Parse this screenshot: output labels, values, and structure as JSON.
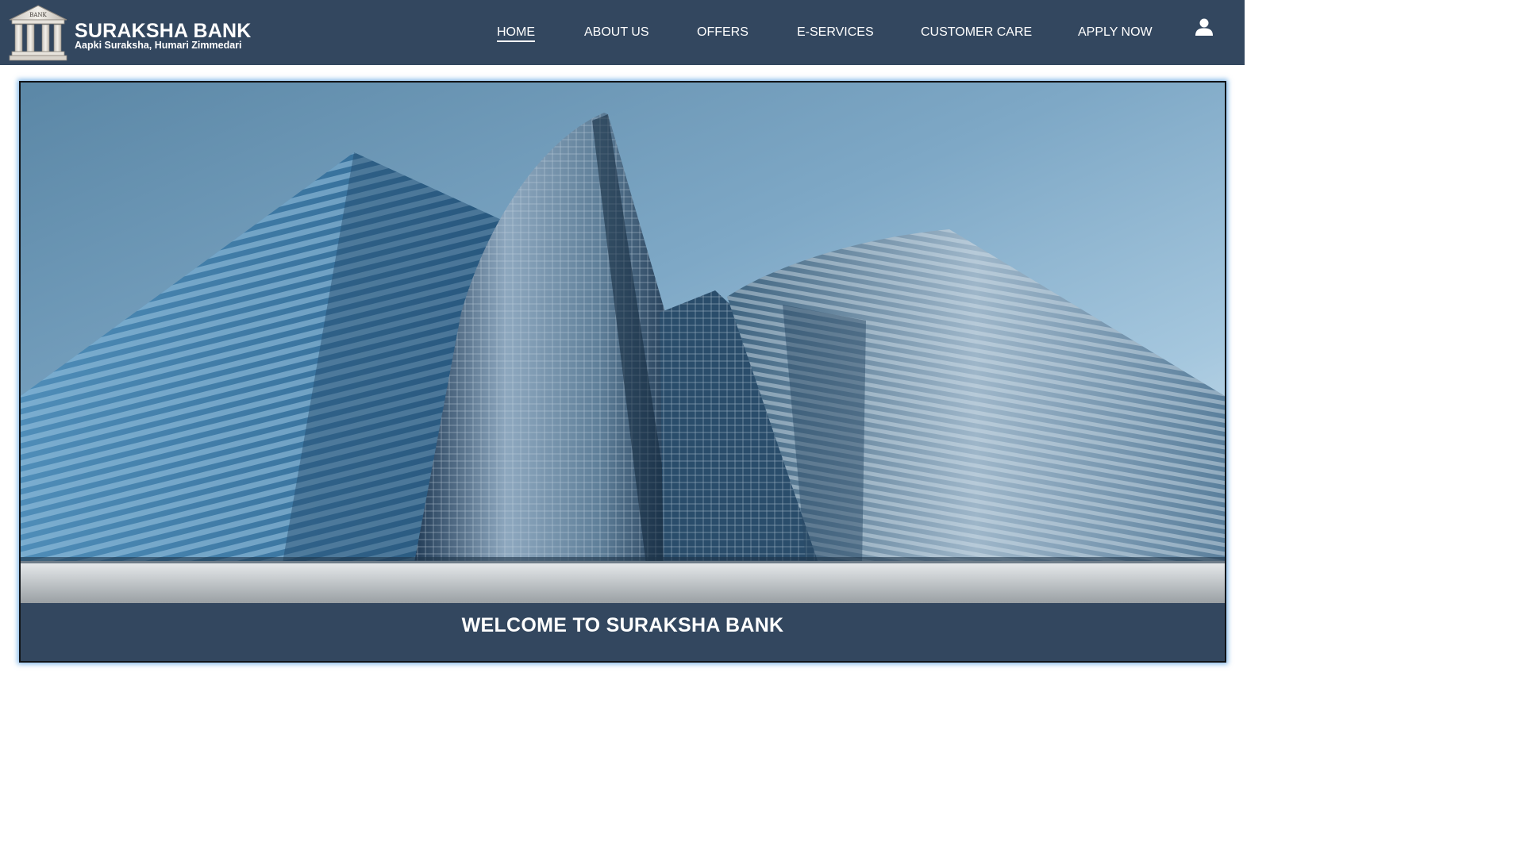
{
  "header": {
    "brand_name": "SURAKSHA BANK",
    "tagline": "Aapki Suraksha, Humari Zimmedari",
    "logo_label": "BANK",
    "logo_icon": "bank-building-icon",
    "nav": [
      {
        "label": "HOME",
        "active": true
      },
      {
        "label": "ABOUT US",
        "active": false
      },
      {
        "label": "OFFERS",
        "active": false
      },
      {
        "label": "E-SERVICES",
        "active": false
      },
      {
        "label": "CUSTOMER CARE",
        "active": false
      },
      {
        "label": "APPLY NOW",
        "active": false
      }
    ],
    "user_icon": "user-account-icon"
  },
  "hero": {
    "image_subject": "glass-skyscrapers-image",
    "caption": "WELCOME TO SURAKSHA BANK"
  },
  "colors": {
    "header_bg": "#33475f",
    "caption_bg": "#33475f",
    "text": "#ffffff",
    "hero_glow": "#5aa0e1"
  }
}
